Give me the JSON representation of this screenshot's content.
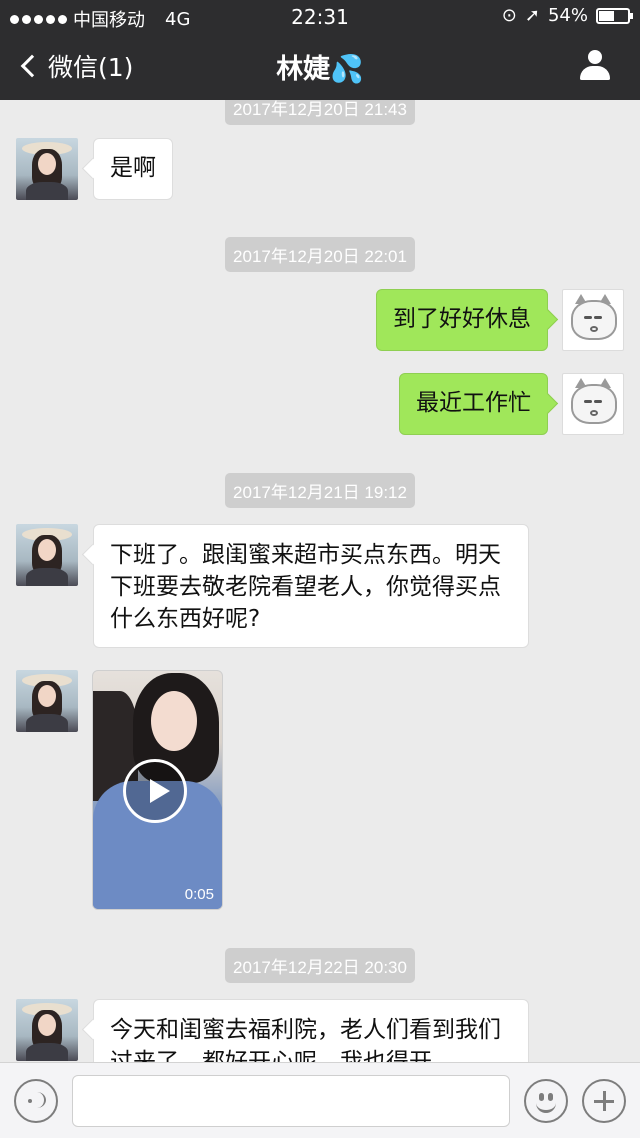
{
  "status_bar": {
    "carrier": "中国移动",
    "network": "4G",
    "time": "22:31",
    "battery": "54%",
    "battery_level": 0.54
  },
  "nav": {
    "back_label": "微信(1)",
    "title": "林婕",
    "title_emoji": "💦"
  },
  "messages": [
    {
      "type": "timestamp",
      "text": "2017年12月20日 21:43"
    },
    {
      "type": "text",
      "side": "left",
      "text": "是啊"
    },
    {
      "type": "timestamp",
      "text": "2017年12月20日 22:01"
    },
    {
      "type": "text",
      "side": "right",
      "text": "到了好好休息"
    },
    {
      "type": "text",
      "side": "right",
      "text": "最近工作忙"
    },
    {
      "type": "timestamp",
      "text": "2017年12月21日 19:12"
    },
    {
      "type": "text",
      "side": "left",
      "text": "下班了。跟闺蜜来超市买点东西。明天下班要去敬老院看望老人，你觉得买点什么东西好呢?"
    },
    {
      "type": "video",
      "side": "left",
      "duration": "0:05"
    },
    {
      "type": "timestamp",
      "text": "2017年12月22日 20:30"
    },
    {
      "type": "text",
      "side": "left",
      "text": "今天和闺蜜去福利院，老人们看到我们过来了，都好开心呢，我也得开"
    }
  ],
  "input_bar": {
    "voice_icon": "voice-icon",
    "emoji_icon": "emoji-icon",
    "plus_icon": "plus-icon"
  }
}
